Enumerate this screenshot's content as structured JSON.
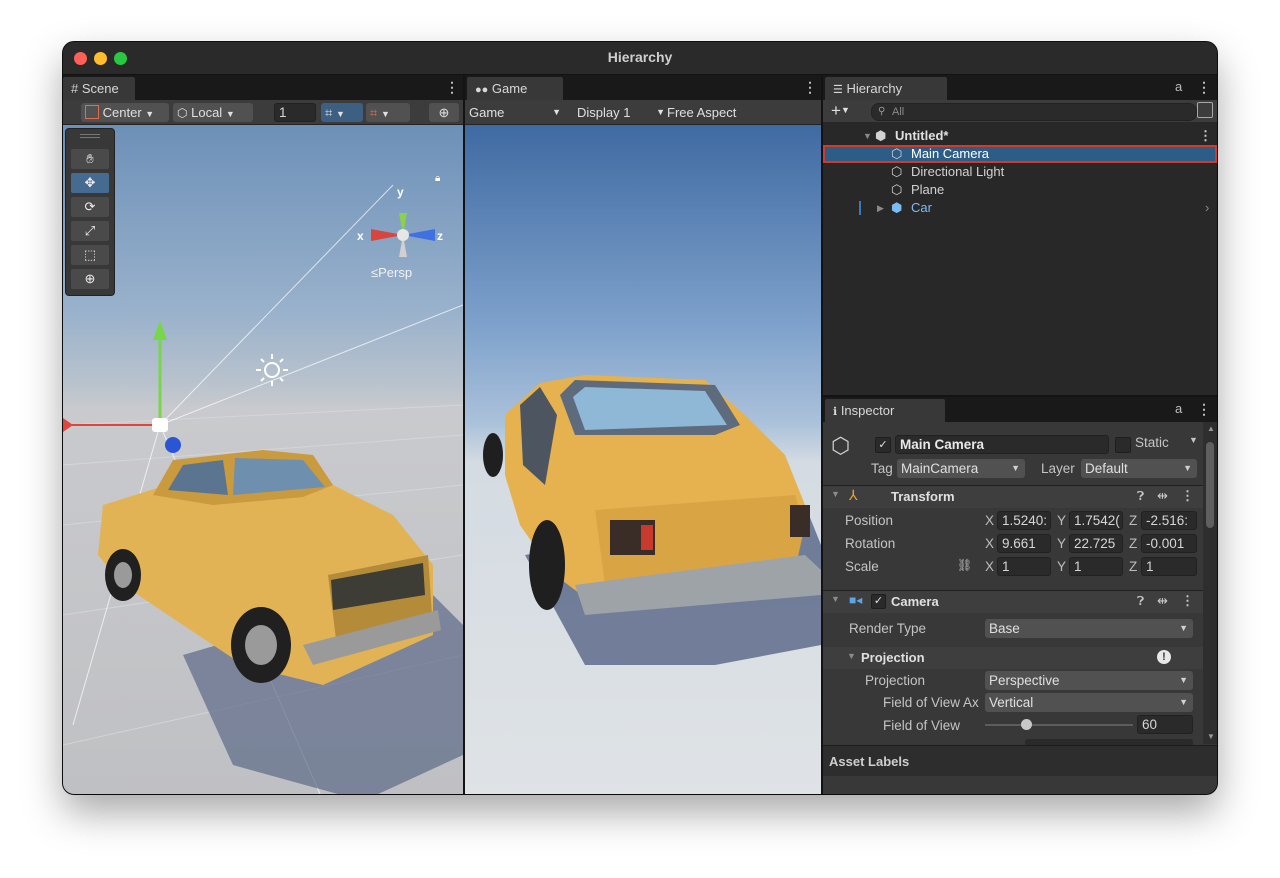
{
  "window": {
    "title": "Hierarchy"
  },
  "scene": {
    "tab_label": "Scene",
    "pivot_label": "Center",
    "space_label": "Local",
    "snap_value": "1",
    "persp_label": "≤Persp",
    "gizmo_axes": {
      "x": "x",
      "y": "y",
      "z": "z"
    }
  },
  "game": {
    "tab_label": "Game",
    "mode_label": "Game",
    "display_label": "Display 1",
    "aspect_label": "Free Aspect"
  },
  "hierarchy": {
    "tab_label": "Hierarchy",
    "search_placeholder": "All",
    "scene_name": "Untitled*",
    "items": [
      {
        "label": "Main Camera",
        "selected": true
      },
      {
        "label": "Directional Light"
      },
      {
        "label": "Plane"
      },
      {
        "label": "Car",
        "prefab": true
      }
    ]
  },
  "inspector": {
    "tab_label": "Inspector",
    "object_name": "Main Camera",
    "static_label": "Static",
    "tag_label": "Tag",
    "tag_value": "MainCamera",
    "layer_label": "Layer",
    "layer_value": "Default",
    "transform": {
      "title": "Transform",
      "position_label": "Position",
      "rotation_label": "Rotation",
      "scale_label": "Scale",
      "position": {
        "x": "1.5240:",
        "y": "1.7542(",
        "z": "-2.516:"
      },
      "rotation": {
        "x": "9.661",
        "y": "22.725",
        "z": "-0.001"
      },
      "scale": {
        "x": "1",
        "y": "1",
        "z": "1"
      }
    },
    "camera": {
      "title": "Camera",
      "render_type_label": "Render Type",
      "render_type_value": "Base",
      "projection_section": "Projection",
      "projection_label": "Projection",
      "projection_value": "Perspective",
      "fov_axis_label": "Field of View Ax",
      "fov_axis_value": "Vertical",
      "fov_label": "Field of View",
      "fov_value": "60",
      "fov_fraction": 0.28
    },
    "asset_labels": "Asset Labels"
  },
  "colors": {
    "selection": "#2c5d87",
    "highlight_box": "#d23a2a",
    "prefab": "#7cbcf4",
    "accent_blue": "#3d79b4"
  }
}
